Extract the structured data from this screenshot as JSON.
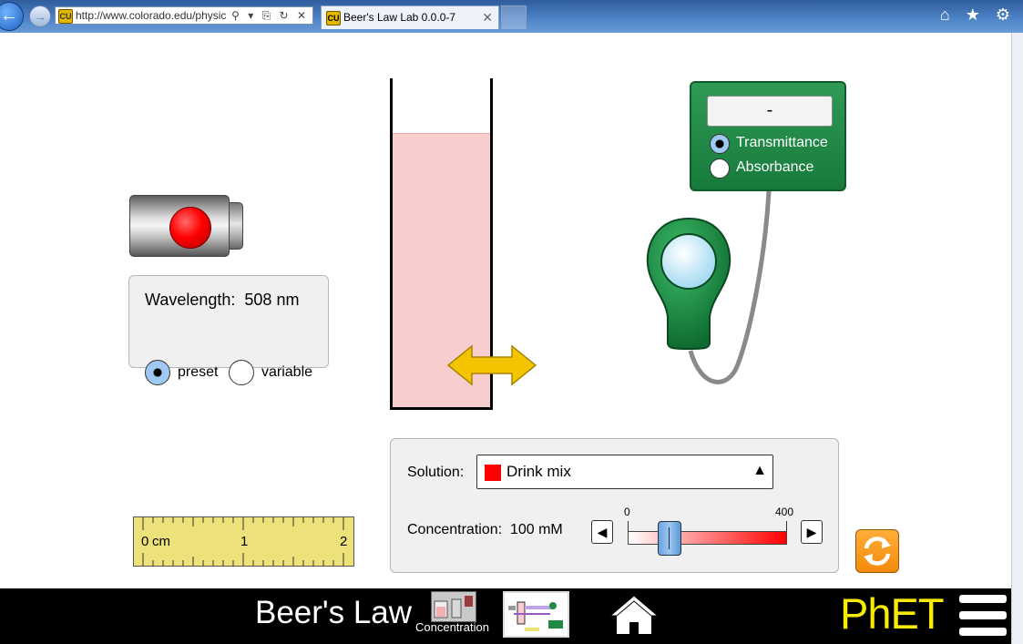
{
  "browser": {
    "address_url": "http://www.colorado.edu/physic",
    "address_controls": "⚲ ▾ ⎘ ↻ ✕",
    "tab_title": "Beer's Law Lab 0.0.0-7",
    "tab_close": "✕",
    "favicon_text": "CU",
    "chrome_icons": "⌂ ★ ⚙",
    "back_glyph": "←",
    "forward_glyph": "→"
  },
  "wavelength": {
    "label": "Wavelength:",
    "value": "508 nm",
    "options": [
      "preset",
      "variable"
    ],
    "selected": "preset"
  },
  "detector": {
    "readout": "-",
    "options": [
      "Transmittance",
      "Absorbance"
    ],
    "selected": "Transmittance"
  },
  "solution": {
    "label": "Solution:",
    "selected": "Drink mix",
    "swatch_color": "#ff0000",
    "dropdown_glyph": "▲"
  },
  "concentration": {
    "label": "Concentration:",
    "value_text": "100 mM",
    "min_label": "0",
    "max_label": "400",
    "value": 100,
    "min": 0,
    "max": 400,
    "decrement_glyph": "◀",
    "increment_glyph": "▶"
  },
  "ruler": {
    "labels": [
      "0",
      "cm",
      "1",
      "2"
    ]
  },
  "navbar": {
    "title": "Beer's Law",
    "screen1_label": "Concentration",
    "logo": "PhET"
  },
  "colors": {
    "accent_green": "#177a3c",
    "liquid": "#f8cdcd",
    "arrow": "#f5c400",
    "reset": "#f28b0c",
    "phet_yellow": "#f7ea06"
  },
  "icons": [
    "back-arrow-icon",
    "forward-arrow-icon",
    "home-icon",
    "star-icon",
    "gear-icon",
    "reset-icon",
    "menu-icon",
    "drag-arrow-icon",
    "laser-icon",
    "probe-icon"
  ]
}
